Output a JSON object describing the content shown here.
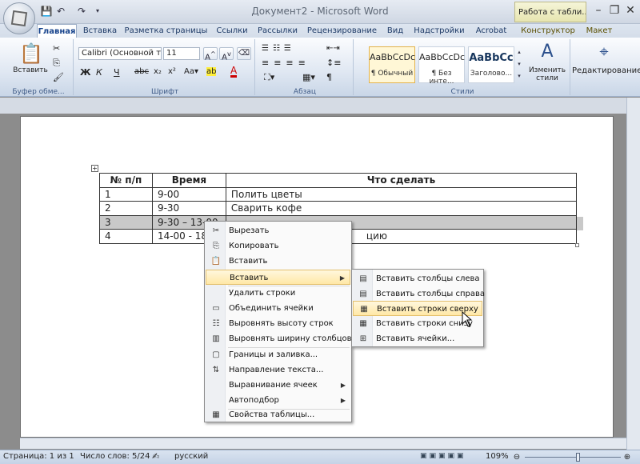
{
  "window": {
    "title": "Документ2 - Microsoft Word",
    "context_tab_title": "Работа с табли..."
  },
  "quick_access": {
    "save": "💾",
    "undo": "↶",
    "redo": "↷"
  },
  "tabs": [
    "Главная",
    "Вставка",
    "Разметка страницы",
    "Ссылки",
    "Рассылки",
    "Рецензирование",
    "Вид",
    "Надстройки",
    "Acrobat",
    "Конструктор",
    "Макет"
  ],
  "ribbon": {
    "paste_label": "Вставить",
    "clipboard_label": "Буфер обме...",
    "font_name": "Calibri (Основной те",
    "font_size": "11",
    "font_label": "Шрифт",
    "paragraph_label": "Абзац",
    "styles_label": "Стили",
    "change_styles": "Изменить стили",
    "editing": "Редактирование",
    "styles": [
      {
        "preview": "AaBbCcDc",
        "name": "¶ Обычный"
      },
      {
        "preview": "AaBbCcDc",
        "name": "¶ Без инте..."
      },
      {
        "preview": "AaBbCc",
        "name": "Заголово..."
      }
    ]
  },
  "table": {
    "headers": [
      "№ п/п",
      "Время",
      "Что сделать"
    ],
    "rows": [
      [
        "1",
        "9-00",
        "Полить цветы"
      ],
      [
        "2",
        "9-30",
        "Сварить кофе"
      ],
      [
        "3",
        "9-30 – 13-00",
        ""
      ],
      [
        "4",
        "14-00 - 18",
        "цию"
      ]
    ]
  },
  "context_menu": {
    "items": [
      "Вырезать",
      "Копировать",
      "Вставить",
      "Вставить",
      "Удалить строки",
      "Объединить ячейки",
      "Выровнять высоту строк",
      "Выровнять ширину столбцов",
      "Границы и заливка...",
      "Направление текста...",
      "Выравнивание ячеек",
      "Автоподбор",
      "Свойства таблицы..."
    ]
  },
  "submenu": {
    "items": [
      "Вставить столбцы слева",
      "Вставить столбцы справа",
      "Вставить строки сверху",
      "Вставить строки снизу",
      "Вставить ячейки..."
    ]
  },
  "status": {
    "page": "Страница: 1 из 1",
    "words": "Число слов: 5/24",
    "language": "русский",
    "zoom": "109%"
  },
  "colors": {
    "accent": "#15428b",
    "highlight": "#ffe8a6",
    "selected_row": "#c9c9c9"
  }
}
